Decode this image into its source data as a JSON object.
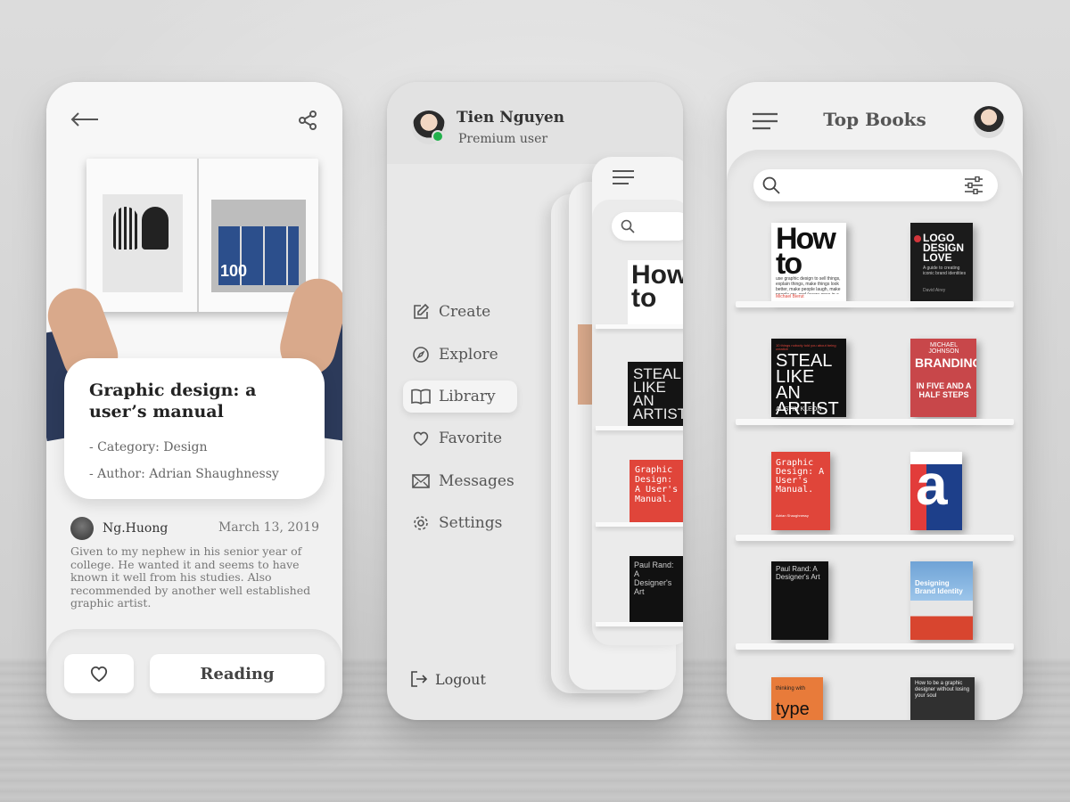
{
  "colors": {
    "accent_online": "#22b14c",
    "branding_red": "#c8474a",
    "graphic_red": "#e0453a"
  },
  "phone1": {
    "back_icon": "arrow-left-icon",
    "share_icon": "share-icon",
    "book_title": "Graphic design: a user’s manual",
    "category": "- Category: Design",
    "author": "- Author: Adrian Shaughnessy",
    "review": {
      "name": "Ng.Huong",
      "date": "March 13, 2019",
      "text": "Given to my nephew in his senior year of college. He wanted it and seems to have known it well from his studies. Also recommended by another well established graphic artist."
    },
    "favorite_icon": "heart-icon",
    "reading_label": "Reading"
  },
  "phone2": {
    "user": {
      "name": "Tien Nguyen",
      "role": "Premium user"
    },
    "menu": [
      {
        "label": "Create",
        "icon": "edit-icon"
      },
      {
        "label": "Explore",
        "icon": "compass-icon"
      },
      {
        "label": "Library",
        "icon": "book-open-icon",
        "active": true
      },
      {
        "label": "Favorite",
        "icon": "heart-icon"
      },
      {
        "label": "Messages",
        "icon": "mail-icon"
      },
      {
        "label": "Settings",
        "icon": "gear-icon"
      }
    ],
    "logout_label": "Logout"
  },
  "phone3": {
    "title": "Top Books",
    "books": [
      {
        "title": "How to",
        "subtitle": "use graphic design to sell things, explain things, make things look better, make people laugh, make people cry, and (every once in a while) change the world",
        "author": "Michael Bierut"
      },
      {
        "title": "LOGO DESIGN LOVE",
        "subtitle": "A guide to creating iconic brand identities",
        "author": "David Airey"
      },
      {
        "title": "STEAL LIKE AN ARTIST",
        "subtitle": "10 things nobody told you about being creative",
        "author": "AUSTIN KLEON"
      },
      {
        "title": "BRANDING",
        "subtitle": "IN FIVE AND A HALF STEPS",
        "author": "MICHAEL JOHNSON"
      },
      {
        "title": "Graphic Design: A User's Manual.",
        "subtitle": "",
        "author": "Adrian Shaughnessy"
      },
      {
        "title": "a",
        "subtitle": "",
        "author": ""
      },
      {
        "title": "Paul Rand: A Designer's Art",
        "subtitle": "",
        "author": ""
      },
      {
        "title": "Designing Brand Identity",
        "subtitle": "",
        "author": ""
      },
      {
        "title": "type",
        "subtitle": "thinking with",
        "author": ""
      },
      {
        "title": "How to be a graphic designer without losing your soul",
        "subtitle": "",
        "author": ""
      }
    ]
  }
}
